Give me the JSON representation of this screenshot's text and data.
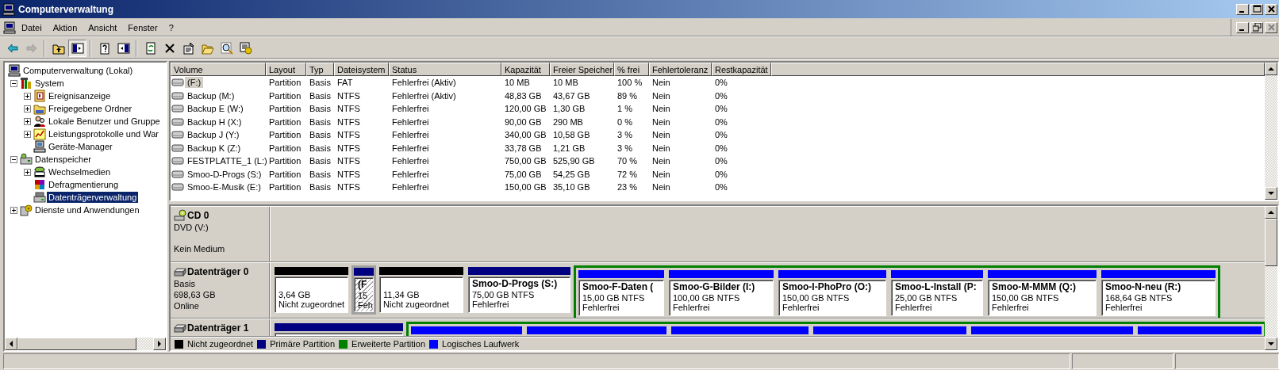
{
  "window": {
    "title": "Computerverwaltung"
  },
  "menu": [
    "Datei",
    "Aktion",
    "Ansicht",
    "Fenster",
    "?"
  ],
  "toolbar": [
    [
      {
        "kind": "back",
        "disabled": false,
        "pressed": false
      },
      {
        "kind": "forward",
        "disabled": true,
        "pressed": false
      }
    ],
    [
      {
        "kind": "up",
        "disabled": false,
        "pressed": false
      },
      {
        "kind": "tree",
        "disabled": false,
        "pressed": true
      }
    ],
    [
      {
        "kind": "help",
        "disabled": false,
        "pressed": false
      },
      {
        "kind": "pane",
        "disabled": false,
        "pressed": false
      }
    ],
    [
      {
        "kind": "refresh",
        "disabled": false,
        "pressed": false
      },
      {
        "kind": "delete",
        "disabled": false,
        "pressed": false
      },
      {
        "kind": "properties",
        "disabled": false,
        "pressed": false
      },
      {
        "kind": "open",
        "disabled": false,
        "pressed": false
      },
      {
        "kind": "search",
        "disabled": false,
        "pressed": false
      },
      {
        "kind": "settings",
        "disabled": false,
        "pressed": false
      }
    ]
  ],
  "tree": [
    {
      "label": "Computerverwaltung (Lokal)",
      "kind": "computer",
      "selected": false,
      "children": [
        {
          "label": "System",
          "kind": "tools",
          "expanded": true,
          "selected": false,
          "children": [
            {
              "label": "Ereignisanzeige",
              "kind": "event",
              "expanded": false,
              "selected": false
            },
            {
              "label": "Freigegebene Ordner",
              "kind": "folder",
              "expanded": false,
              "selected": false
            },
            {
              "label": "Lokale Benutzer und Gruppe",
              "kind": "users",
              "expanded": false,
              "selected": false
            },
            {
              "label": "Leistungsprotokolle und War",
              "kind": "perf",
              "expanded": false,
              "selected": false
            },
            {
              "label": "Geräte-Manager",
              "kind": "device",
              "selected": false
            }
          ]
        },
        {
          "label": "Datenspeicher",
          "kind": "storage",
          "expanded": true,
          "selected": false,
          "children": [
            {
              "label": "Wechselmedien",
              "kind": "media",
              "expanded": false,
              "selected": false
            },
            {
              "label": "Defragmentierung",
              "kind": "defrag",
              "selected": false
            },
            {
              "label": "Datenträgerverwaltung",
              "kind": "diskmgmt",
              "selected": true
            }
          ]
        },
        {
          "label": "Dienste und Anwendungen",
          "kind": "services",
          "expanded": false,
          "selected": false
        }
      ]
    }
  ],
  "table": {
    "columns": [
      "Volume",
      "Layout",
      "Typ",
      "Dateisystem",
      "Status",
      "Kapazität",
      "Freier Speicher",
      "% frei",
      "Fehlertoleranz",
      "Restkapazität"
    ],
    "rows": [
      {
        "selected": true,
        "cells": [
          "(F:)",
          "Partition",
          "Basis",
          "FAT",
          "Fehlerfrei (Aktiv)",
          "10 MB",
          "10 MB",
          "100 %",
          "Nein",
          "0%"
        ]
      },
      {
        "selected": false,
        "cells": [
          "Backup (M:)",
          "Partition",
          "Basis",
          "NTFS",
          "Fehlerfrei (Aktiv)",
          "48,83 GB",
          "43,67 GB",
          "89 %",
          "Nein",
          "0%"
        ]
      },
      {
        "selected": false,
        "cells": [
          "Backup E (W:)",
          "Partition",
          "Basis",
          "NTFS",
          "Fehlerfrei",
          "120,00 GB",
          "1,30 GB",
          "1 %",
          "Nein",
          "0%"
        ]
      },
      {
        "selected": false,
        "cells": [
          "Backup H (X:)",
          "Partition",
          "Basis",
          "NTFS",
          "Fehlerfrei",
          "90,00 GB",
          "290 MB",
          "0 %",
          "Nein",
          "0%"
        ]
      },
      {
        "selected": false,
        "cells": [
          "Backup J (Y:)",
          "Partition",
          "Basis",
          "NTFS",
          "Fehlerfrei",
          "340,00 GB",
          "10,58 GB",
          "3 %",
          "Nein",
          "0%"
        ]
      },
      {
        "selected": false,
        "cells": [
          "Backup K (Z:)",
          "Partition",
          "Basis",
          "NTFS",
          "Fehlerfrei",
          "33,78 GB",
          "1,21 GB",
          "3 %",
          "Nein",
          "0%"
        ]
      },
      {
        "selected": false,
        "cells": [
          "FESTPLATTE_1 (L:)",
          "Partition",
          "Basis",
          "NTFS",
          "Fehlerfrei",
          "750,00 GB",
          "525,90 GB",
          "70 %",
          "Nein",
          "0%"
        ]
      },
      {
        "selected": false,
        "cells": [
          "Smoo-D-Progs (S:)",
          "Partition",
          "Basis",
          "NTFS",
          "Fehlerfrei",
          "75,00 GB",
          "54,25 GB",
          "72 %",
          "Nein",
          "0%"
        ]
      },
      {
        "selected": false,
        "cells": [
          "Smoo-E-Musik (E:)",
          "Partition",
          "Basis",
          "NTFS",
          "Fehlerfrei",
          "150,00 GB",
          "35,10 GB",
          "23 %",
          "Nein",
          "0%"
        ]
      }
    ]
  },
  "disks": [
    {
      "kind": "cd",
      "name": "CD 0",
      "lines": [
        "DVD (V:)",
        "Kein Medium"
      ]
    },
    {
      "kind": "disk",
      "name": "Datenträger 0",
      "lines": [
        "Basis",
        "698,63 GB",
        "Online"
      ],
      "partitions": [
        {
          "kind": "unallocated",
          "selected": false,
          "size": "3,64 GB",
          "status": "Nicht zugeordnet"
        },
        {
          "kind": "primary",
          "selected": true,
          "name": "(F",
          "size": "15",
          "status": "Feh"
        },
        {
          "kind": "unallocated",
          "selected": false,
          "size": "11,34 GB",
          "status": "Nicht zugeordnet"
        },
        {
          "kind": "primary",
          "selected": false,
          "name": "Smoo-D-Progs  (S:)",
          "size": "75,00 GB NTFS",
          "status": "Fehlerfrei"
        },
        {
          "kind": "extended",
          "children": [
            {
              "kind": "logical",
              "selected": false,
              "name": "Smoo-F-Daten  (",
              "size": "15,00 GB NTFS",
              "status": "Fehlerfrei"
            },
            {
              "kind": "logical",
              "selected": false,
              "name": "Smoo-G-Bilder  (I:)",
              "size": "100,00 GB NTFS",
              "status": "Fehlerfrei"
            },
            {
              "kind": "logical",
              "selected": false,
              "name": "Smoo-I-PhoPro  (O:)",
              "size": "150,00 GB NTFS",
              "status": "Fehlerfrei"
            },
            {
              "kind": "logical",
              "selected": false,
              "name": "Smoo-L-Install  (P:",
              "size": "25,00 GB NTFS",
              "status": "Fehlerfrei"
            },
            {
              "kind": "logical",
              "selected": false,
              "name": "Smoo-M-MMM  (Q:)",
              "size": "150,00 GB NTFS",
              "status": "Fehlerfrei"
            },
            {
              "kind": "logical",
              "selected": false,
              "name": "Smoo-N-neu  (R:)",
              "size": "168,64 GB NTFS",
              "status": "Fehlerfrei"
            }
          ]
        }
      ]
    },
    {
      "kind": "disk",
      "name": "Datenträger 1",
      "partitions": [
        {
          "kind": "primary",
          "selected": false
        },
        {
          "kind": "extended",
          "children": [
            {
              "kind": "logical",
              "selected": false
            },
            {
              "kind": "logical",
              "selected": false
            },
            {
              "kind": "logical",
              "selected": false
            },
            {
              "kind": "logical",
              "selected": false
            },
            {
              "kind": "logical",
              "selected": false
            },
            {
              "kind": "logical",
              "selected": false
            }
          ]
        }
      ]
    }
  ],
  "legend": [
    {
      "label": "Nicht zugeordnet",
      "color": "#000000"
    },
    {
      "label": "Primäre Partition",
      "color": "#000080"
    },
    {
      "label": "Erweiterte Partition",
      "color": "#008000"
    },
    {
      "label": "Logisches Laufwerk",
      "color": "#0000ff"
    }
  ]
}
